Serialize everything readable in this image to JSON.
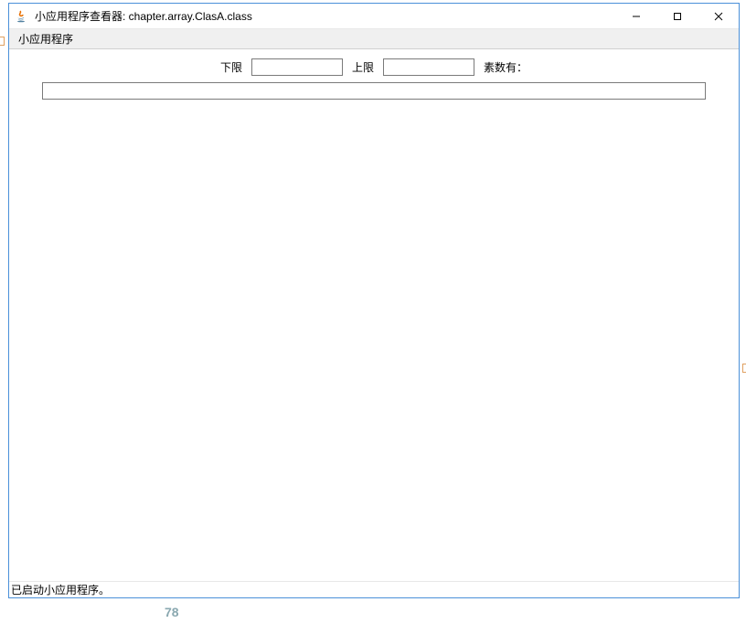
{
  "titlebar": {
    "title": "小应用程序查看器: chapter.array.ClasA.class"
  },
  "menubar": {
    "applet_menu": "小应用程序"
  },
  "applet": {
    "lower_label": "下限",
    "lower_value": "",
    "upper_label": "上限",
    "upper_value": "",
    "primes_label": "素数有：",
    "result_value": ""
  },
  "statusbar": {
    "text": "已启动小应用程序。"
  },
  "bg": {
    "num": "78"
  }
}
